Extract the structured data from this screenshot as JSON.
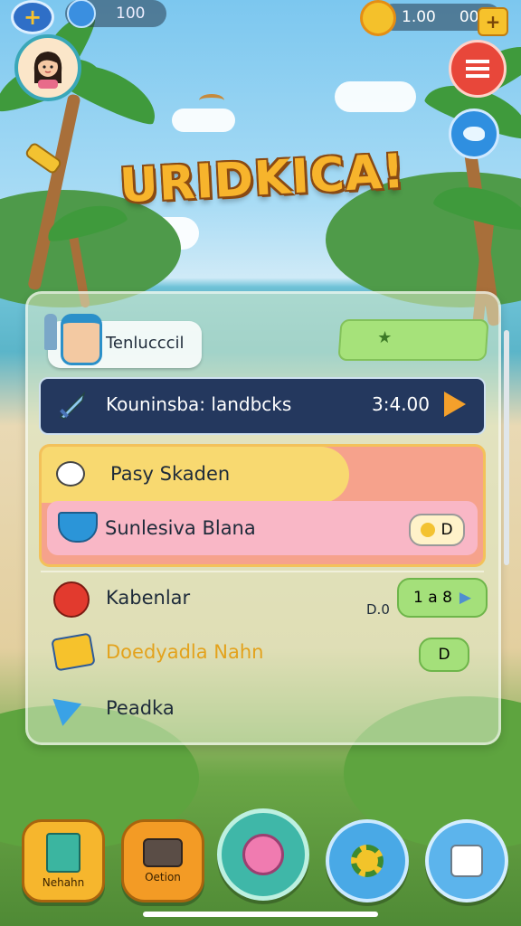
{
  "header": {
    "left_value": "100",
    "right_value_a": "1.00",
    "right_value_b": "000"
  },
  "title": "URIDKICA!",
  "profile": {
    "name": "Tenlucccil"
  },
  "mission_bar": {
    "label": "Kouninsba: landbcks",
    "value": "3:4.00"
  },
  "tasks": [
    {
      "label": "Pasy Skaden"
    },
    {
      "label": "Sunlesiva Blana",
      "badge": "D"
    }
  ],
  "list": [
    {
      "label": "Kabenlar",
      "value_left": "D.0",
      "badge": "1 a  8"
    },
    {
      "label": "Doedyadla Nahn",
      "badge": "D"
    },
    {
      "label": "Peadka"
    }
  ],
  "nav": [
    {
      "label": "Nehahn",
      "icon": "book-icon",
      "color": "#f6b62d"
    },
    {
      "label": "Oetion",
      "icon": "camera-icon",
      "color": "#f39b25"
    },
    {
      "label": "",
      "icon": "lollipop-icon",
      "color": "#3fb7a8"
    },
    {
      "label": "",
      "icon": "gear-icon",
      "color": "#49a9e6"
    },
    {
      "label": "",
      "icon": "dice-icon",
      "color": "#5cb4ec"
    }
  ],
  "colors": {
    "accent": "#f7b42c",
    "mission_bg": "#24385e",
    "task_yellow": "#f8d970",
    "task_pink": "#f9b7c6",
    "green_badge": "#9ad86a"
  }
}
